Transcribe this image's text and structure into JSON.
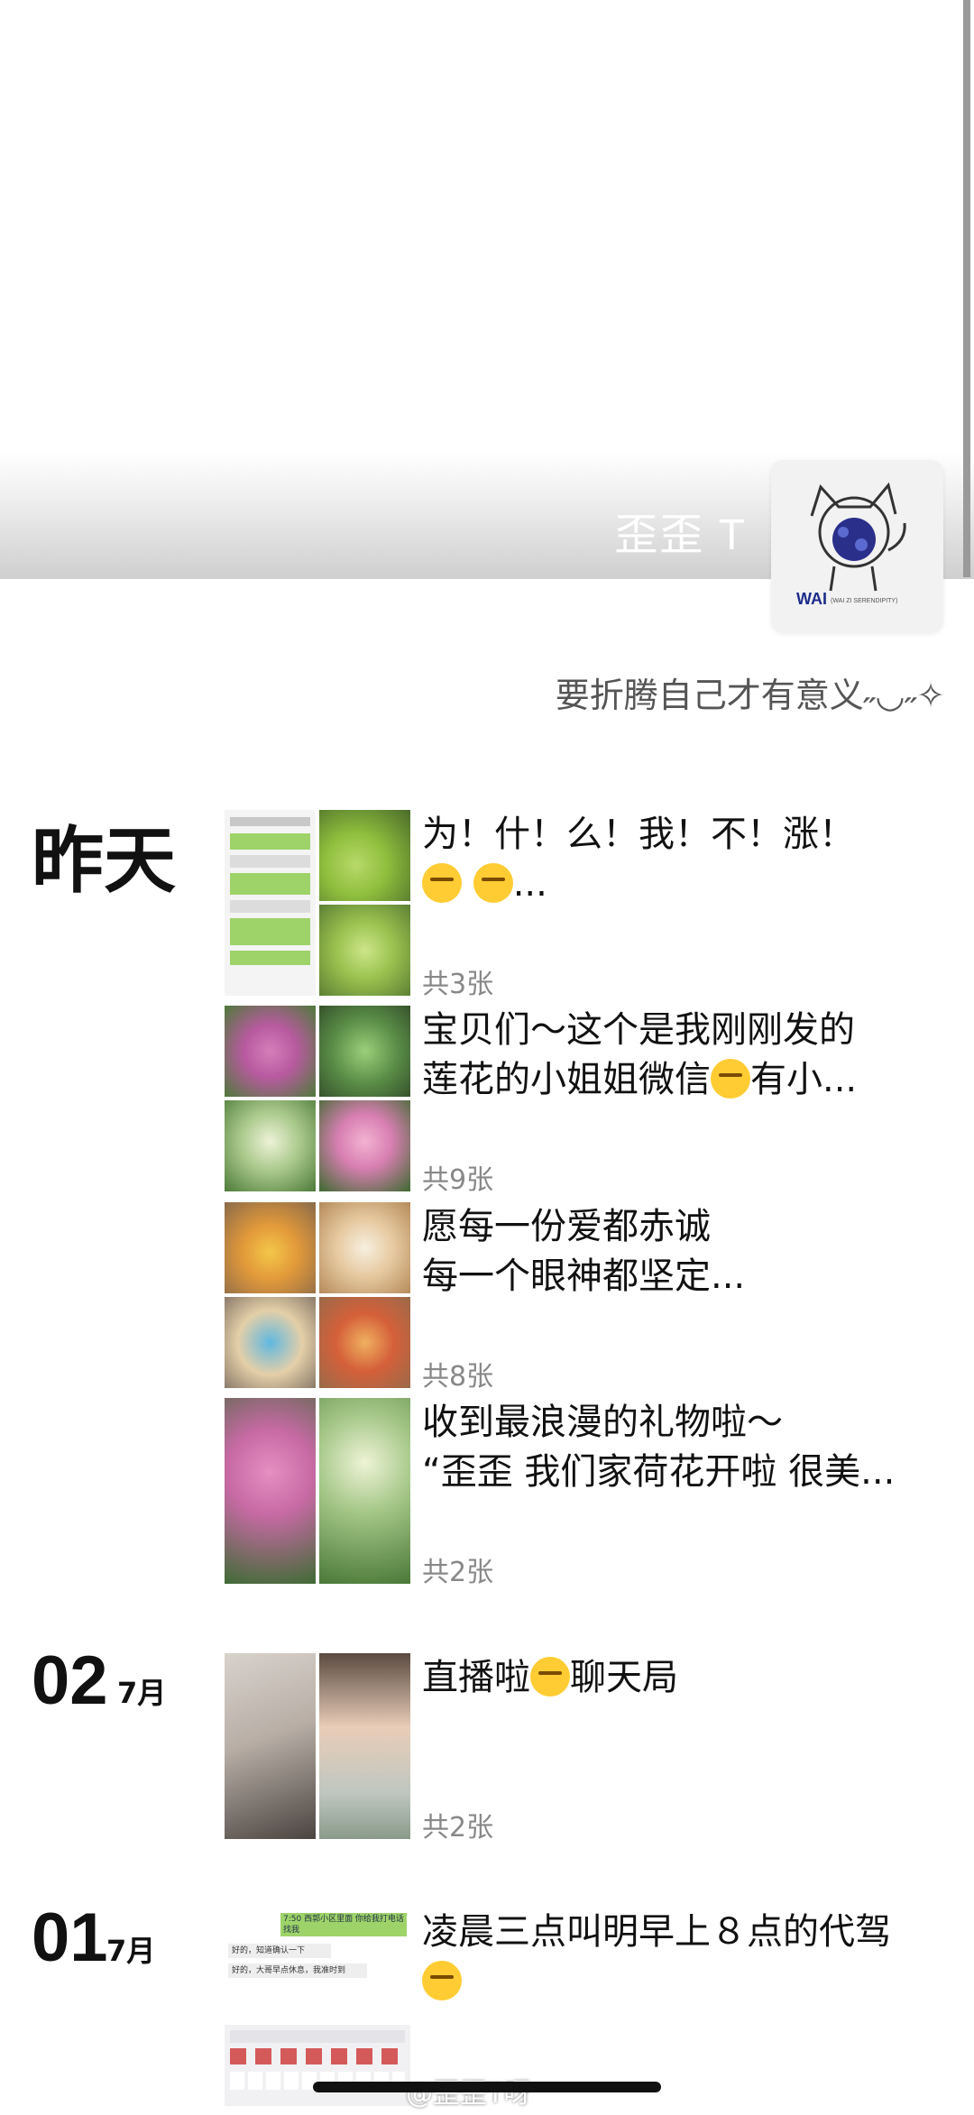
{
  "profile": {
    "name": "歪歪 T",
    "signature": "要折腾自己才有意义˶◡˶✧",
    "avatar_caption": "WAI  (WAI ZI SERENDIPITY)"
  },
  "sections": [
    {
      "date_label": "昨天",
      "posts": [
        {
          "text_line1": "为！什！么！我！不！涨！",
          "text_line2": "...",
          "count": "共3张"
        },
        {
          "text_line1": "宝贝们～这个是我刚刚发的",
          "text_line2": "莲花的小姐姐微信",
          "text_line2_tail": "有小...",
          "count": "共9张"
        },
        {
          "text_line1": "愿每一份爱都赤诚",
          "text_line2": "每一个眼神都坚定...",
          "count": "共8张"
        },
        {
          "text_line1": "收到最浪漫的礼物啦～",
          "text_line2": "“歪歪 我们家荷花开啦 很美...",
          "count": "共2张"
        }
      ]
    },
    {
      "day": "02",
      "month": "7月",
      "posts": [
        {
          "text_head": "直播啦",
          "text_tail": "聊天局",
          "count": "共2张"
        }
      ]
    },
    {
      "day": "01",
      "month": "7月",
      "posts": [
        {
          "text_line1": "凌晨三点叫明早上８点的代驾",
          "chat_bubble_top": "7:50 西郭小区里面 你给我打电话找我",
          "chat_line_a": "好的，知道确认一下",
          "chat_line_b": "好的，大哥早点休息，我准时到"
        }
      ]
    }
  ],
  "watermark": "@歪歪T呀",
  "colors": {
    "thumb_green": "#7fb24a",
    "lotus_pink": "#d986b5",
    "leaf": "#5a8a3a",
    "food": "#e9a04a"
  }
}
